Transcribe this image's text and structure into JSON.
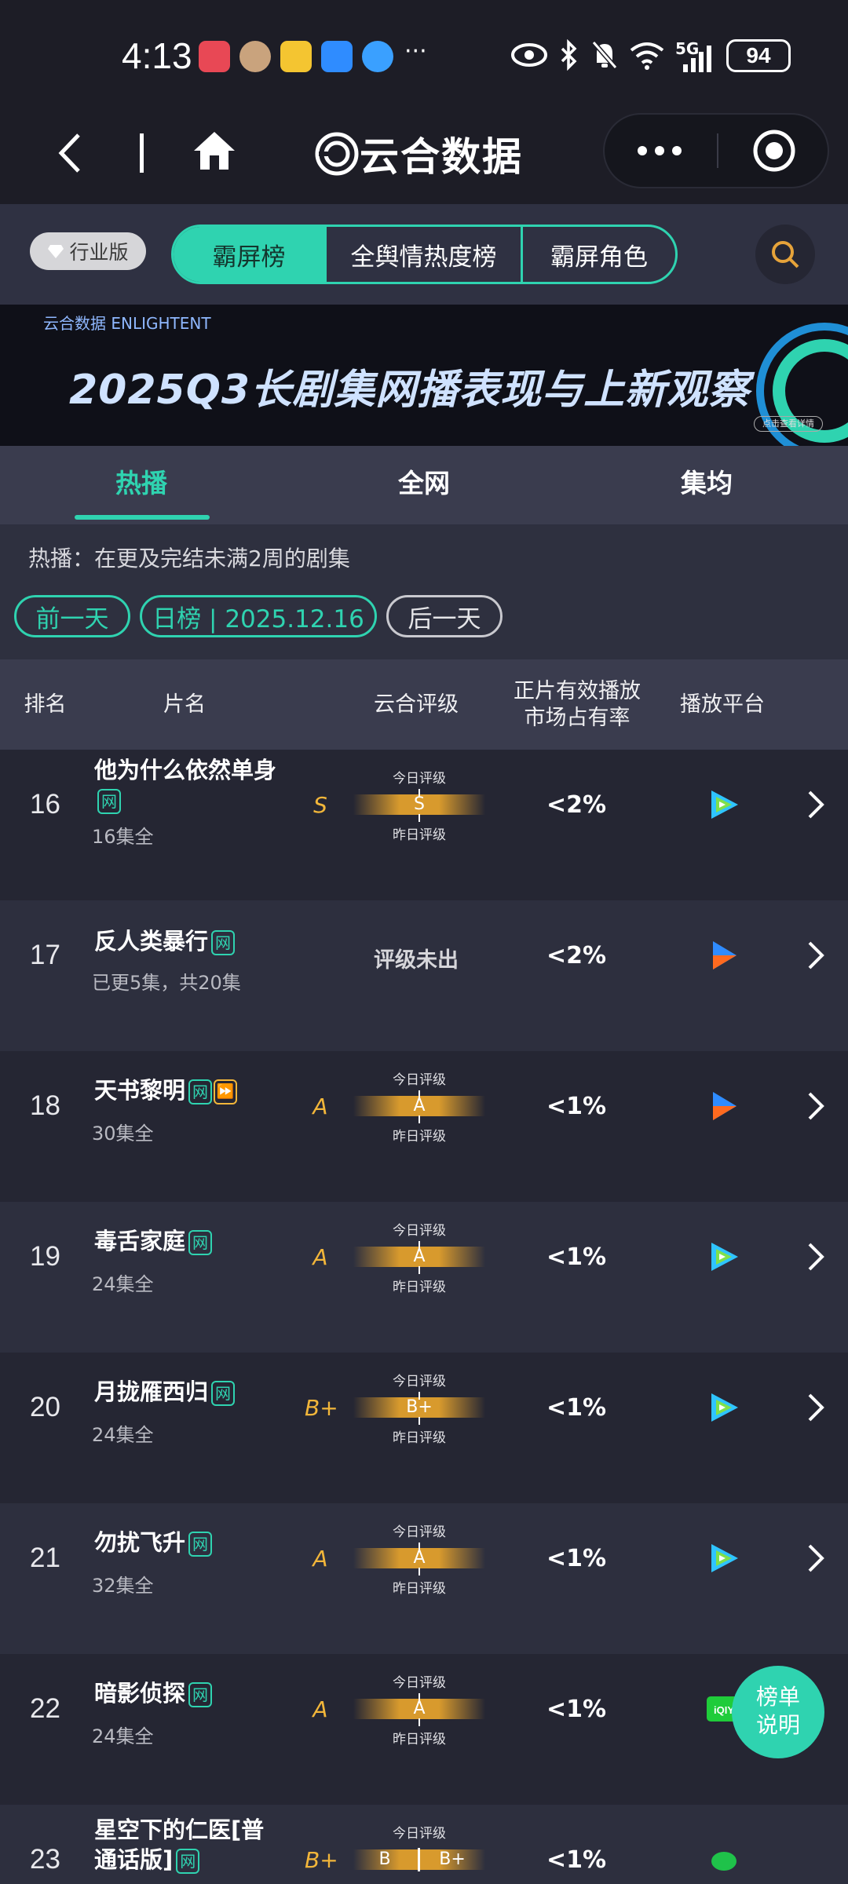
{
  "status": {
    "time": "4:13",
    "network": "5G",
    "battery": "94"
  },
  "nav": {
    "title": "云合数据"
  },
  "tabs": {
    "industry": "行业版",
    "segments": [
      "霸屏榜",
      "全舆情热度榜",
      "霸屏角色"
    ]
  },
  "banner": {
    "logo": "云合数据 ENLIGHTENT",
    "title": "2025Q3长剧集网播表现与上新观察",
    "button": "点击查看详情"
  },
  "subtabs": [
    "热播",
    "全网",
    "集均"
  ],
  "info": {
    "desc": "热播：在更及完结未满2周的剧集",
    "prev": "前一天",
    "date": "日榜 | 2025.12.16",
    "next": "后一天"
  },
  "table": {
    "headers": {
      "rank": "排名",
      "name": "片名",
      "grade": "云合评级",
      "share_line1": "正片有效播放",
      "share_line2": "市场占有率",
      "platform": "播放平台"
    },
    "label_today": "今日评级",
    "label_yesterday": "昨日评级",
    "pending_text": "评级未出",
    "network_tag": "网",
    "rows": [
      {
        "rank": "16",
        "name": "他为什么依然单身",
        "sub": "16集全",
        "grade": "S",
        "gauge": "S",
        "share": "<2%",
        "platform": "tencent"
      },
      {
        "rank": "17",
        "name": "反人类暴行",
        "sub": "已更5集，共20集",
        "share": "<2%",
        "platform": "youku"
      },
      {
        "rank": "18",
        "name": "天书黎明",
        "sub": "30集全",
        "grade": "A",
        "gauge": "A",
        "share": "<1%",
        "platform": "youku"
      },
      {
        "rank": "19",
        "name": "毒舌家庭",
        "sub": "24集全",
        "grade": "A",
        "gauge": "A",
        "share": "<1%",
        "platform": "tencent"
      },
      {
        "rank": "20",
        "name": "月拢雁西归",
        "sub": "24集全",
        "grade": "B+",
        "gauge": "B+",
        "share": "<1%",
        "platform": "tencent"
      },
      {
        "rank": "21",
        "name": "勿扰飞升",
        "sub": "32集全",
        "grade": "A",
        "gauge": "A",
        "share": "<1%",
        "platform": "tencent"
      },
      {
        "rank": "22",
        "name": "暗影侦探",
        "sub": "24集全",
        "grade": "A",
        "gauge": "A",
        "share": "<1%",
        "platform": "iqiyi"
      },
      {
        "rank": "23",
        "name": "星空下的仁医[普通话版]",
        "grade": "B+",
        "gauge_left": "B",
        "gauge_right": "B+",
        "share": "<1%",
        "platform": "mango"
      }
    ]
  },
  "legend_button": {
    "line1": "榜单",
    "line2": "说明"
  },
  "colors": {
    "accent": "#2fd3b0",
    "grade": "#f2b63a",
    "background": "#22232f"
  }
}
